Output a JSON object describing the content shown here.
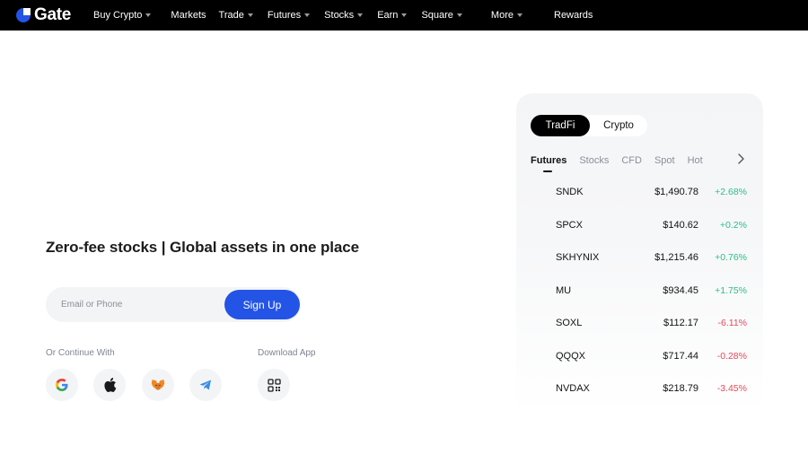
{
  "nav": {
    "logo_text": "Gate",
    "items": [
      {
        "label": "Buy Crypto",
        "dropdown": true
      },
      {
        "label": "Markets",
        "dropdown": false
      },
      {
        "label": "Trade",
        "dropdown": true
      },
      {
        "label": "Futures",
        "dropdown": true
      },
      {
        "label": "Stocks",
        "dropdown": true
      },
      {
        "label": "Earn",
        "dropdown": true
      },
      {
        "label": "Square",
        "dropdown": true
      },
      {
        "label": "More",
        "dropdown": true
      }
    ],
    "rewards": "Rewards"
  },
  "hero": {
    "headline": "Zero-fee stocks | Global assets in one place",
    "input_placeholder": "Email or Phone",
    "signup_label": "Sign Up",
    "continue_label": "Or Continue With",
    "download_label": "Download App",
    "socials": [
      "google-icon",
      "apple-icon",
      "metamask-icon",
      "telegram-icon"
    ],
    "download_icon": "qr-code-icon"
  },
  "market": {
    "segments": [
      "TradFi",
      "Crypto"
    ],
    "active_segment": "TradFi",
    "tabs": [
      "Futures",
      "Stocks",
      "CFD",
      "Spot",
      "Hot"
    ],
    "active_tab": "Futures",
    "rows": [
      {
        "symbol": "SNDK",
        "price": "$1,490.78",
        "change": "+2.68%",
        "dir": "up"
      },
      {
        "symbol": "SPCX",
        "price": "$140.62",
        "change": "+0.2%",
        "dir": "up"
      },
      {
        "symbol": "SKHYNIX",
        "price": "$1,215.46",
        "change": "+0.76%",
        "dir": "up"
      },
      {
        "symbol": "MU",
        "price": "$934.45",
        "change": "+1.75%",
        "dir": "up"
      },
      {
        "symbol": "SOXL",
        "price": "$112.17",
        "change": "-6.11%",
        "dir": "down"
      },
      {
        "symbol": "QQQX",
        "price": "$717.44",
        "change": "-0.28%",
        "dir": "down"
      },
      {
        "symbol": "NVDAX",
        "price": "$218.79",
        "change": "-3.45%",
        "dir": "down"
      }
    ]
  },
  "colors": {
    "nav_bg": "#000000",
    "brand_blue": "#2354e6",
    "up": "#2dbd85",
    "down": "#e5485a"
  }
}
